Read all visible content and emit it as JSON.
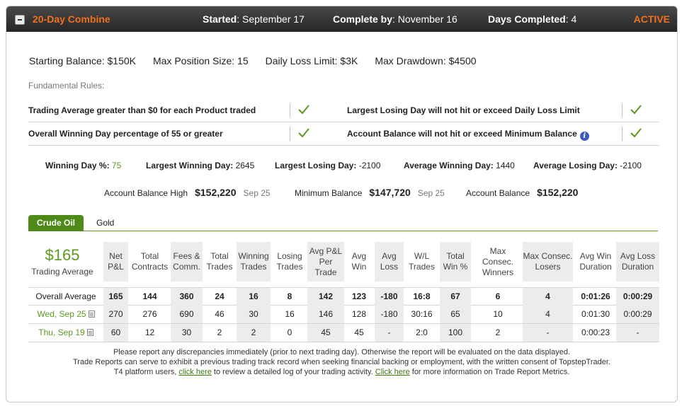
{
  "header": {
    "title": "20-Day Combine",
    "started_label": "Started",
    "started_value": "September 17",
    "complete_label": "Complete by",
    "complete_value": "November 16",
    "days_label": "Days Completed",
    "days_value": "4",
    "status": "ACTIVE"
  },
  "limits": {
    "starting_balance": "Starting Balance: $150K",
    "max_position": "Max Position Size: 15",
    "daily_loss": "Daily Loss Limit: $3K",
    "max_drawdown": "Max Drawdown: $4500"
  },
  "rules": {
    "title": "Fundamental Rules:",
    "items": [
      "Trading Average greater than $0 for each Product traded",
      "Largest Losing Day will not hit or exceed Daily Loss Limit",
      "Overall Winning Day percentage of 55 or greater",
      "Account Balance will not hit or exceed Minimum Balance"
    ]
  },
  "stats": {
    "winning_day_label": "Winning Day %",
    "winning_day_value": "75",
    "largest_win_label": "Largest Winning Day:",
    "largest_win_value": "2645",
    "largest_loss_label": "Largest Losing Day:",
    "largest_loss_value": "-2100",
    "avg_win_label": "Average Winning Day:",
    "avg_win_value": "1440",
    "avg_loss_label": "Average Losing Day:",
    "avg_loss_value": "-2100",
    "balance_high_label": "Account Balance High",
    "balance_high_value": "$152,220",
    "balance_high_date": "Sep 25",
    "min_balance_label": "Minimum Balance",
    "min_balance_value": "$147,720",
    "min_balance_date": "Sep 25",
    "balance_label": "Account Balance",
    "balance_value": "$152,220"
  },
  "tabs": [
    "Crude Oil",
    "Gold"
  ],
  "table": {
    "trading_average_value": "$165",
    "trading_average_label": "Trading Average",
    "headers": [
      "Net P&L",
      "Total Contracts",
      "Fees & Comm.",
      "Total Trades",
      "Winning Trades",
      "Losing Trades",
      "Avg P&L Per Trade",
      "Avg Win",
      "Avg Loss",
      "W/L Trades",
      "Total Win %",
      "Max Consec. Winners",
      "Max Consec. Losers",
      "Avg Win Duration",
      "Avg Loss Duration"
    ],
    "rows": [
      {
        "label": "Overall Average",
        "cells": [
          "165",
          "144",
          "360",
          "24",
          "16",
          "8",
          "142",
          "123",
          "-180",
          "16:8",
          "67",
          "6",
          "4",
          "0:01:26",
          "0:00:29"
        ]
      },
      {
        "label": "Wed, Sep 25",
        "cells": [
          "270",
          "276",
          "690",
          "46",
          "30",
          "16",
          "146",
          "128",
          "-180",
          "30:16",
          "65",
          "10",
          "4",
          "0:01:30",
          "0:00:29"
        ]
      },
      {
        "label": "Thu, Sep 19",
        "cells": [
          "60",
          "12",
          "30",
          "2",
          "2",
          "0",
          "45",
          "45",
          "-",
          "2:0",
          "100",
          "2",
          "-",
          "0:00:23",
          "-"
        ]
      }
    ]
  },
  "footer": {
    "line1": "Please report any discrepancies immediately (prior to next trading day). Otherwise the report will be evaluated on the data displayed.",
    "line2": "Trade Reports can serve to exhibit a previous trading track record when seeking financial backing or employment, with the written consent of TopstepTrader.",
    "line3_a": "T4 platform users, ",
    "link1": "click here",
    "line3_b": " to review a detailed log of your trading activity. ",
    "link2": "Click here",
    "line3_c": " for more information on Trade Report Metrics."
  },
  "colors": {
    "accent_orange": "#f07020",
    "green": "#5a9a1f",
    "tab_green": "#4f8a18"
  }
}
